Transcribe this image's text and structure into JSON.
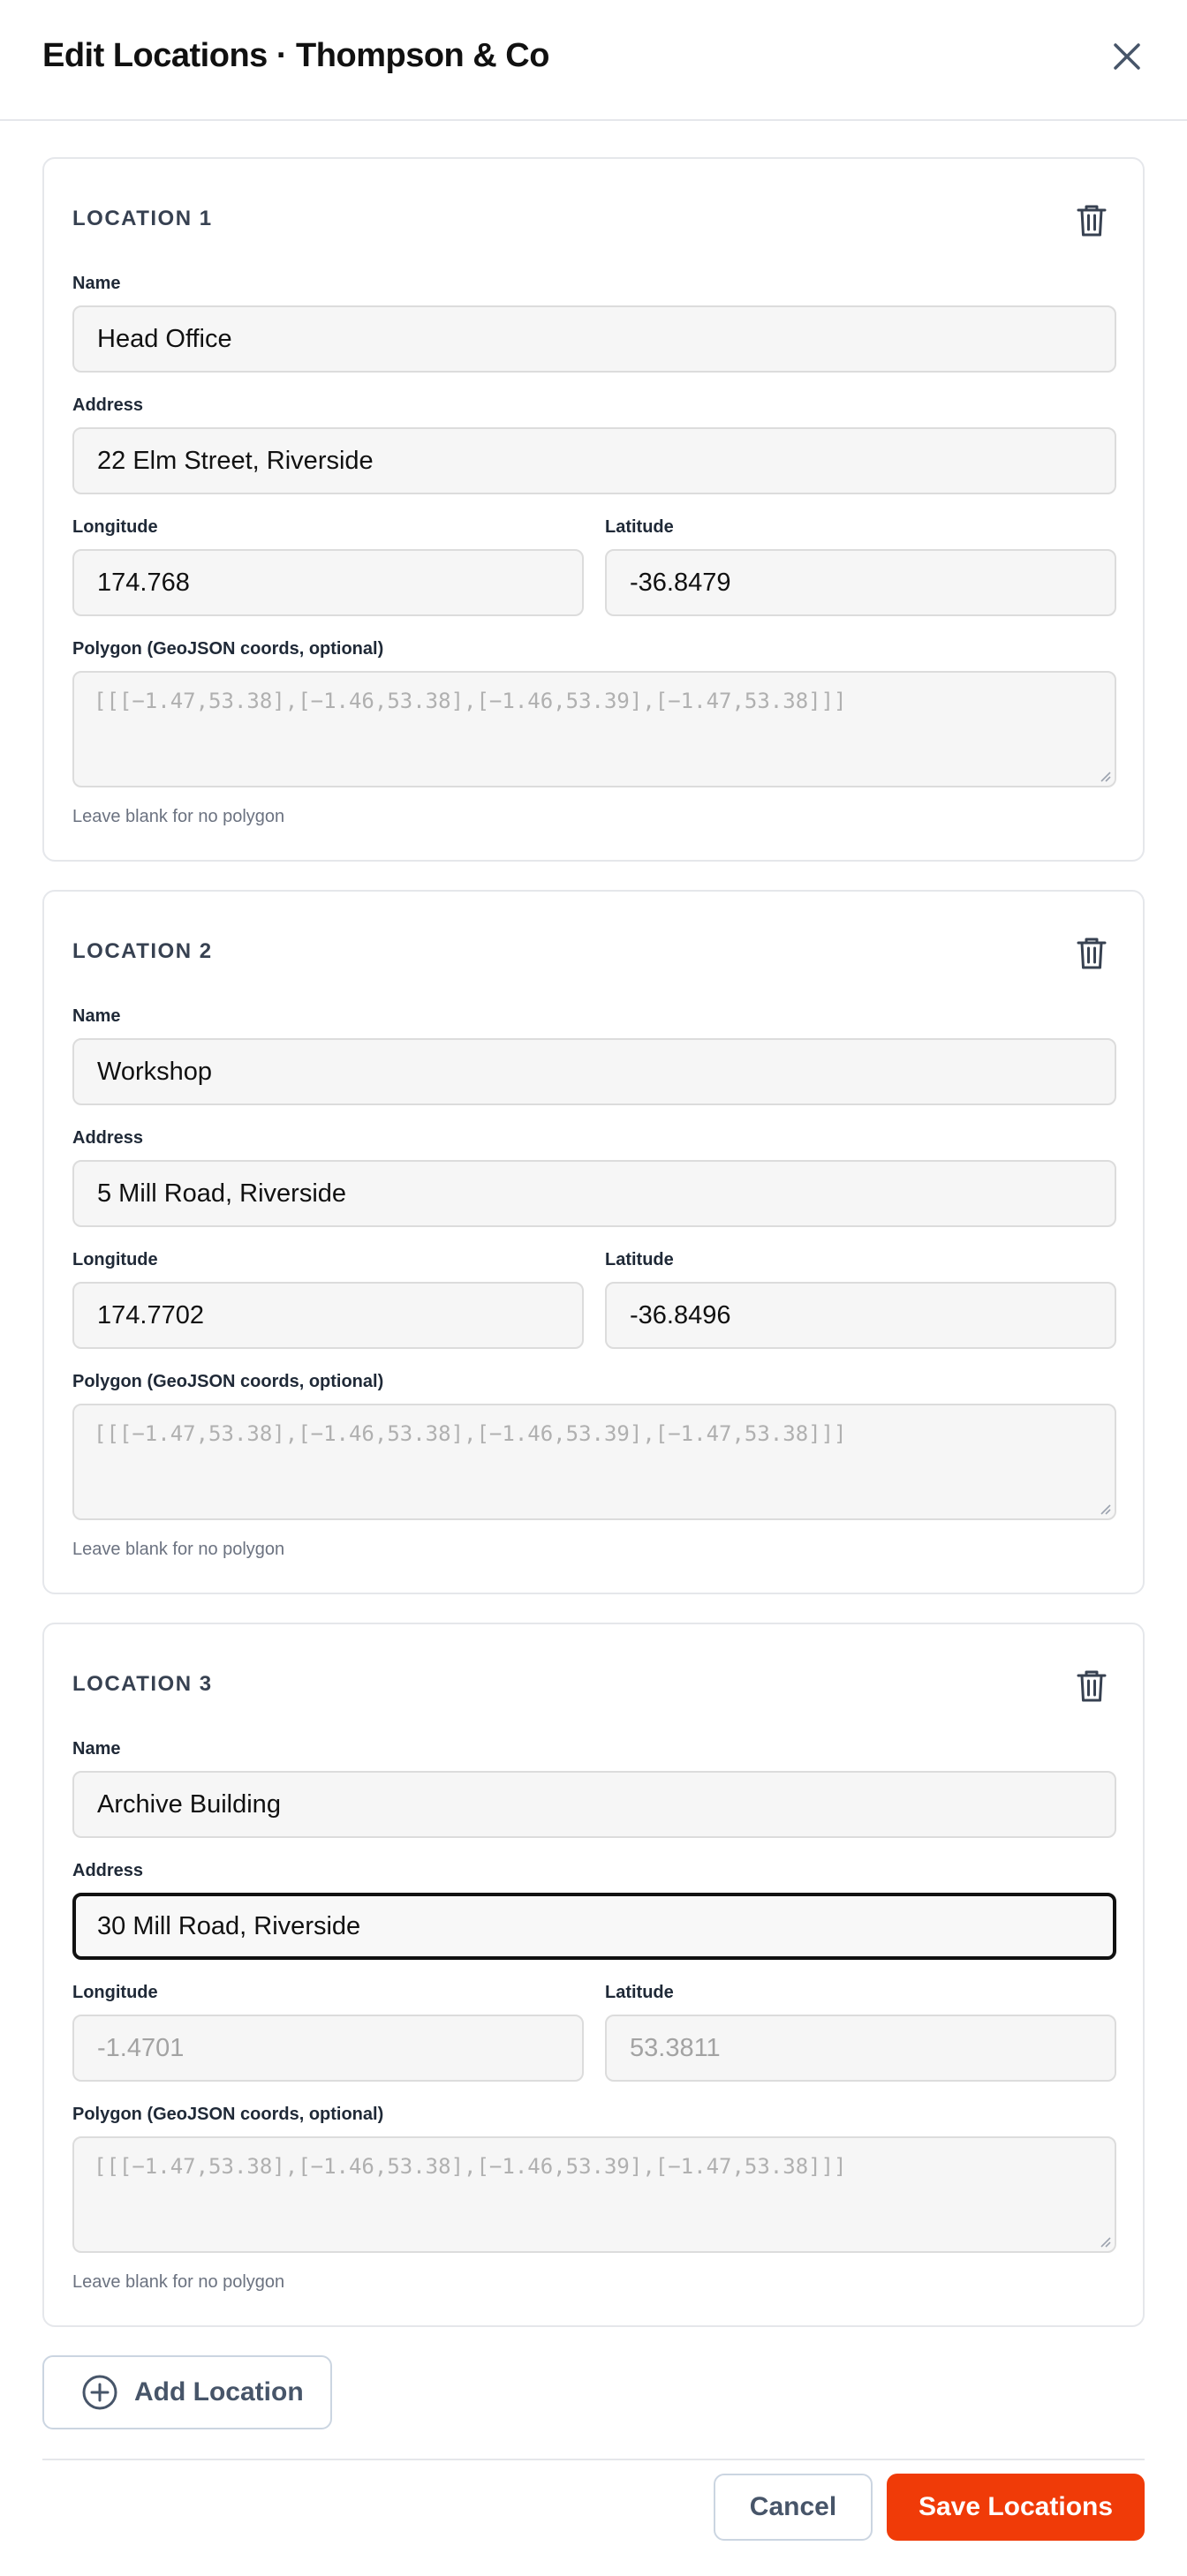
{
  "modal": {
    "title": "Edit Locations · Thompson & Co"
  },
  "labels": {
    "name": "Name",
    "address": "Address",
    "longitude": "Longitude",
    "latitude": "Latitude",
    "polygon": "Polygon (GeoJSON coords, optional)",
    "polygon_hint": "Leave blank for no polygon"
  },
  "locations": [
    {
      "title": "LOCATION 1",
      "name": "Head Office",
      "address": "22 Elm Street, Riverside",
      "longitude": "174.768",
      "latitude": "-36.8479",
      "polygon_placeholder": "[[[−1.47,53.38],[−1.46,53.38],[−1.46,53.39],[−1.47,53.38]]]"
    },
    {
      "title": "LOCATION 2",
      "name": "Workshop",
      "address": "5 Mill Road, Riverside",
      "longitude": "174.7702",
      "latitude": "-36.8496",
      "polygon_placeholder": "[[[−1.47,53.38],[−1.46,53.38],[−1.46,53.39],[−1.47,53.38]]]"
    },
    {
      "title": "LOCATION 3",
      "name": "Archive Building",
      "address": "30 Mill Road, Riverside",
      "longitude_placeholder": "-1.4701",
      "latitude_placeholder": "53.3811",
      "polygon_placeholder": "[[[−1.47,53.38],[−1.46,53.38],[−1.46,53.39],[−1.47,53.38]]]"
    }
  ],
  "actions": {
    "add_location": "Add Location",
    "cancel": "Cancel",
    "save": "Save Locations"
  },
  "icons": {
    "close": "close-icon",
    "delete": "trash-icon",
    "add": "plus-circle-icon"
  },
  "colors": {
    "primary": "#f03b08",
    "border": "#e5e7eb",
    "input_bg": "#f6f6f6",
    "focus_border": "#111111"
  }
}
